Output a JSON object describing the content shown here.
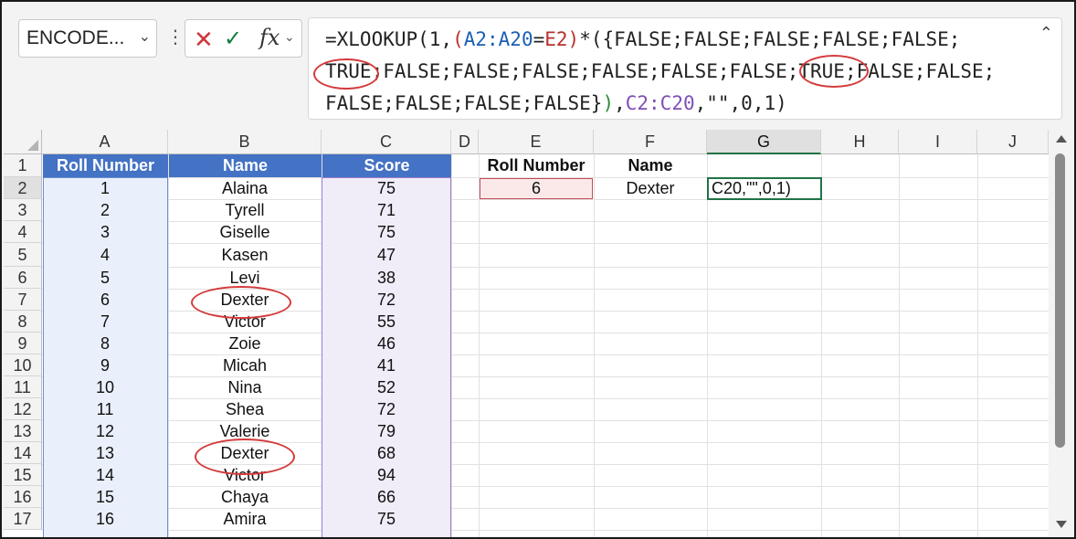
{
  "namebox": {
    "value": "ENCODE..."
  },
  "formula_bar": {
    "fx_label": "fx",
    "line1": [
      {
        "t": "=XLOOKUP(1,",
        "c": ""
      },
      {
        "t": "(",
        "c": "f-red"
      },
      {
        "t": "A2:A20",
        "c": "f-blue"
      },
      {
        "t": "=",
        "c": ""
      },
      {
        "t": "E2",
        "c": "f-red"
      },
      {
        "t": ")",
        "c": "f-red"
      },
      {
        "t": "*(",
        "c": ""
      },
      {
        "t": "{FALSE;FALSE;FALSE;FALSE;FALSE;",
        "c": ""
      }
    ],
    "line2": "TRUE;FALSE;FALSE;FALSE;FALSE;FALSE;FALSE;TRUE;FALSE;FALSE;",
    "line3": [
      {
        "t": "FALSE;FALSE;FALSE;FALSE}",
        "c": ""
      },
      {
        "t": ")",
        "c": "f-green"
      },
      {
        "t": ",",
        "c": ""
      },
      {
        "t": "C2:C20",
        "c": "f-purple"
      },
      {
        "t": ",\"\",0,1)",
        "c": ""
      }
    ]
  },
  "columns": [
    "A",
    "B",
    "C",
    "D",
    "E",
    "F",
    "G",
    "H",
    "I",
    "J"
  ],
  "row_numbers": [
    "1",
    "2",
    "3",
    "4",
    "5",
    "6",
    "7",
    "8",
    "9",
    "10",
    "11",
    "12",
    "13",
    "14",
    "15",
    "16",
    "17"
  ],
  "table": {
    "headers": [
      "Roll Number",
      "Name",
      "Score"
    ],
    "rows": [
      [
        "1",
        "Alaina",
        "75"
      ],
      [
        "2",
        "Tyrell",
        "71"
      ],
      [
        "3",
        "Giselle",
        "75"
      ],
      [
        "4",
        "Kasen",
        "47"
      ],
      [
        "5",
        "Levi",
        "38"
      ],
      [
        "6",
        "Dexter",
        "72"
      ],
      [
        "7",
        "Victor",
        "55"
      ],
      [
        "8",
        "Zoie",
        "46"
      ],
      [
        "9",
        "Micah",
        "41"
      ],
      [
        "10",
        "Nina",
        "52"
      ],
      [
        "11",
        "Shea",
        "72"
      ],
      [
        "12",
        "Valerie",
        "79"
      ],
      [
        "13",
        "Dexter",
        "68"
      ],
      [
        "14",
        "Victor",
        "94"
      ],
      [
        "15",
        "Chaya",
        "66"
      ],
      [
        "16",
        "Amira",
        "75"
      ]
    ]
  },
  "lookup": {
    "label_roll": "Roll Number",
    "label_name": "Name",
    "roll_value": "6",
    "name_value": "Dexter",
    "editing_text": "C20,\"\",0,1)"
  },
  "selected_column": "G",
  "selected_row": "2",
  "colors": {
    "header_fill": "#4472c4",
    "annotation_circle": "#d43a3a",
    "active_cell_border": "#217346"
  }
}
